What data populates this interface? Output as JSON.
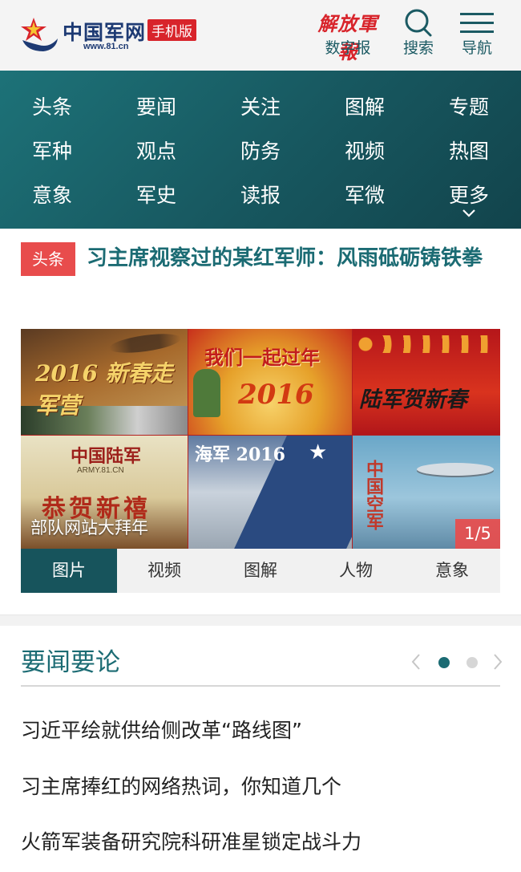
{
  "header": {
    "logo_title": "中国军网",
    "logo_badge": "手机版",
    "logo_url": "www.81.cn",
    "newspaper_calligraphy": "解放軍報",
    "newspaper_label": "数字报",
    "search_label": "搜索",
    "nav_label": "导航"
  },
  "nav": {
    "items": [
      "头条",
      "要闻",
      "关注",
      "图解",
      "专题",
      "军种",
      "观点",
      "防务",
      "视频",
      "热图",
      "意象",
      "军史",
      "读报",
      "军微",
      "更多"
    ]
  },
  "headline": {
    "tag": "头条",
    "text": "习主席视察过的某红军师：风雨砥砺铸铁拳"
  },
  "slider": {
    "tiles": [
      {
        "title": "2016 新春走军营"
      },
      {
        "title": "我们一起过年"
      },
      {
        "title": "陆军贺新春"
      },
      {
        "title": "中国陆军"
      },
      {
        "title": "海军 2016"
      },
      {
        "title": "中国空军"
      }
    ],
    "tile_subtexts": {
      "tile2": "2016",
      "tile4_url": "ARMY.81.CN",
      "tile4_banner": "恭贺新禧"
    },
    "caption": "部队网站大拜年",
    "counter": "1/5"
  },
  "tabs": [
    "图片",
    "视频",
    "图解",
    "人物",
    "意象"
  ],
  "news_section": {
    "title": "要闻要论",
    "items": [
      "习近平绘就供给侧改革“路线图”",
      "习主席捧红的网络热词，你知道几个",
      "火箭军装备研究院科研准星锁定战斗力"
    ]
  },
  "colors": {
    "teal": "#1b6b73",
    "nav_dark": "#17575f",
    "red": "#d8242b",
    "tag_red": "#e84c4c"
  }
}
